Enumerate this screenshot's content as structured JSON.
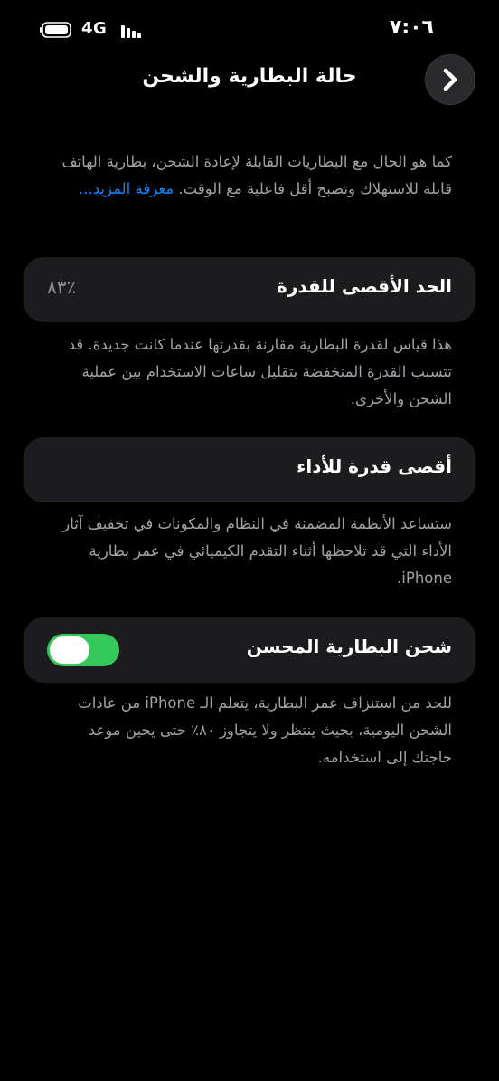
{
  "status_bar": {
    "network": "4G",
    "time": "٧:٠٦",
    "battery_icon": "battery-full-icon",
    "signal_icon": "signal-bars-icon"
  },
  "nav": {
    "title": "حالة البطارية والشحن",
    "back_icon": "chevron-right-icon"
  },
  "intro": {
    "text": "كما هو الحال مع البطاريات القابلة لإعادة الشحن، بطارية الهاتف قابلة للاستهلاك وتصبح أقل فاعلية مع الوقت.",
    "link": "معرفة المزيد..."
  },
  "max_capacity": {
    "label": "الحد الأقصى للقدرة",
    "value": "٪٨٣",
    "description": "هذا قياس لقدرة البطارية مقارنة بقدرتها عندما كانت جديدة. قد تتسبب القدرة المنخفضة بتقليل ساعات الاستخدام بين عملية الشحن والأخرى."
  },
  "peak_performance": {
    "label": "أقصى قدرة للأداء",
    "description": "ستساعد الأنظمة المضمنة في النظام والمكونات في تخفيف آثار الأداء التي قد تلاحظها أثناء التقدم الكيميائي في عمر بطارية iPhone."
  },
  "optimized_charging": {
    "label": "شحن البطارية المحسن",
    "enabled": true,
    "description": "للحد من استنزاف عمر البطارية، يتعلم الـ iPhone من عادات الشحن اليومية، بحيث ينتظر ولا يتجاوز ٨٠٪ حتى يحين موعد حاجتك إلى استخدامه."
  },
  "colors": {
    "background": "#000000",
    "card": "#1c1c1e",
    "secondary_text": "#a1a1a6",
    "link": "#0a84ff",
    "toggle_on": "#34c759"
  }
}
